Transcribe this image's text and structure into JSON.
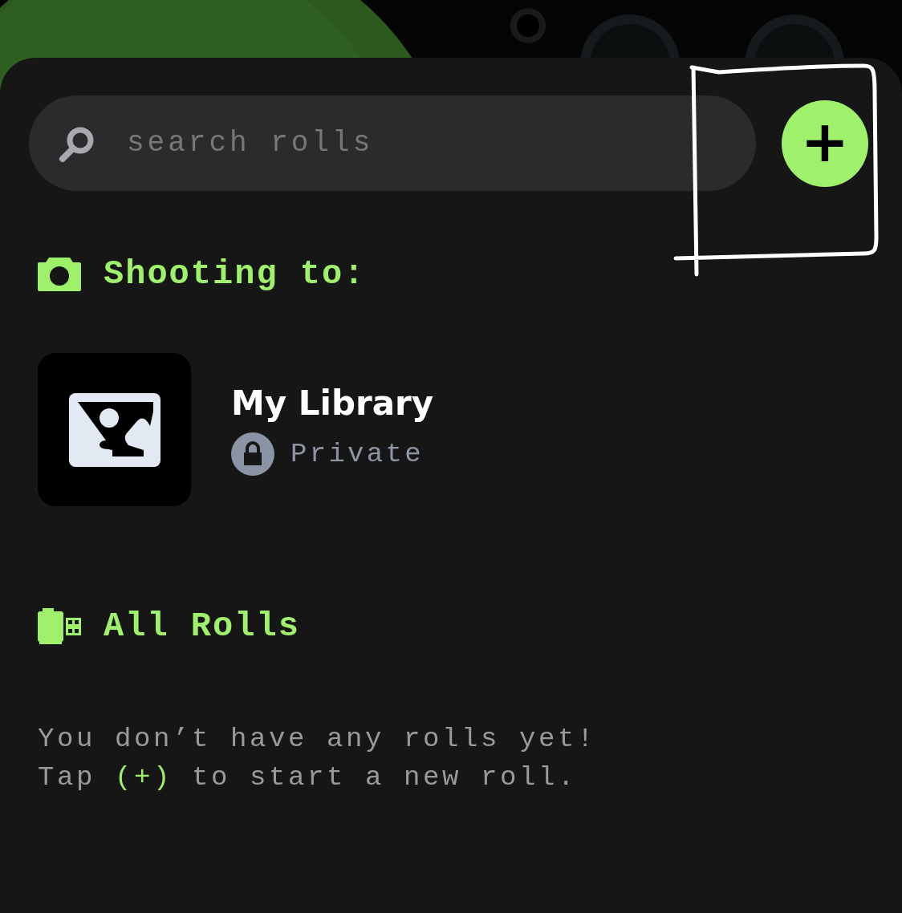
{
  "search": {
    "placeholder": "search rolls"
  },
  "add_button": {
    "label": "+"
  },
  "shooting_section": {
    "title": "Shooting to:"
  },
  "library": {
    "name": "My Library",
    "privacy": "Private",
    "locked": true
  },
  "rolls_section": {
    "title": "All Rolls"
  },
  "empty_state": {
    "lines": [
      [
        {
          "text": "You don’t have any rolls yet!",
          "highlight": false
        }
      ],
      [
        {
          "text": "Tap ",
          "highlight": false
        },
        {
          "text": "(+)",
          "highlight": true
        },
        {
          "text": " to start a new roll.",
          "highlight": false
        }
      ]
    ]
  },
  "annotation": {
    "kind": "frame"
  }
}
